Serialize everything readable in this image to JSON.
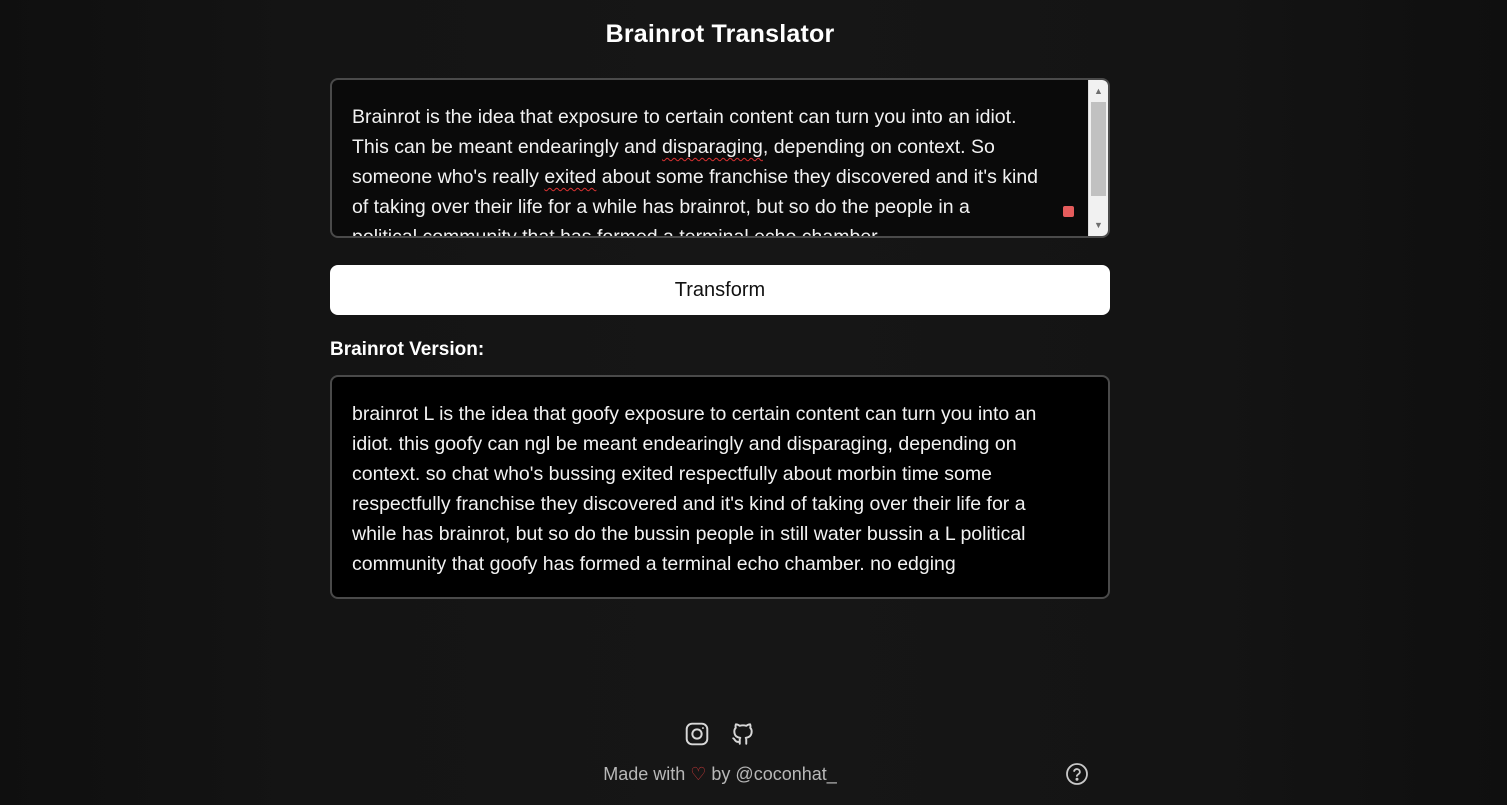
{
  "app": {
    "title": "Brainrot Translator"
  },
  "input": {
    "line1": "Brainrot is the idea that exposure to certain content can turn you into an idiot.",
    "line2_pre": "This can be meant endearingly and ",
    "line2_misspelled": "disparaging",
    "line2_post": ", depending on context. So",
    "line3_pre": "someone who's really ",
    "line3_misspelled": "exited",
    "line3_post": " about some franchise they discovered and it's kind",
    "line4": "of taking over their life for a while has brainrot, but so do the people in a",
    "line5": "political community that has formed a terminal echo chamber."
  },
  "transform_button": {
    "label": "Transform"
  },
  "output": {
    "label": "Brainrot Version:",
    "text": "brainrot L is the idea that goofy exposure to certain content can turn you into an idiot. this goofy can ngl be meant endearingly and disparaging, depending on context. so chat who's bussing exited respectfully about morbin time some respectfully franchise they discovered and it's kind of taking over their life for a while has brainrot, but so do the bussin people in still water bussin a L political community that goofy has formed a terminal echo chamber. no edging"
  },
  "footer": {
    "made_with": "Made with",
    "by": "by @coconhat_"
  },
  "colors": {
    "background": "#121212",
    "accent_heart": "#c83a3a",
    "indicator": "#e55c5c"
  },
  "icons": [
    "instagram-icon",
    "github-icon",
    "help-icon",
    "heart-icon"
  ]
}
